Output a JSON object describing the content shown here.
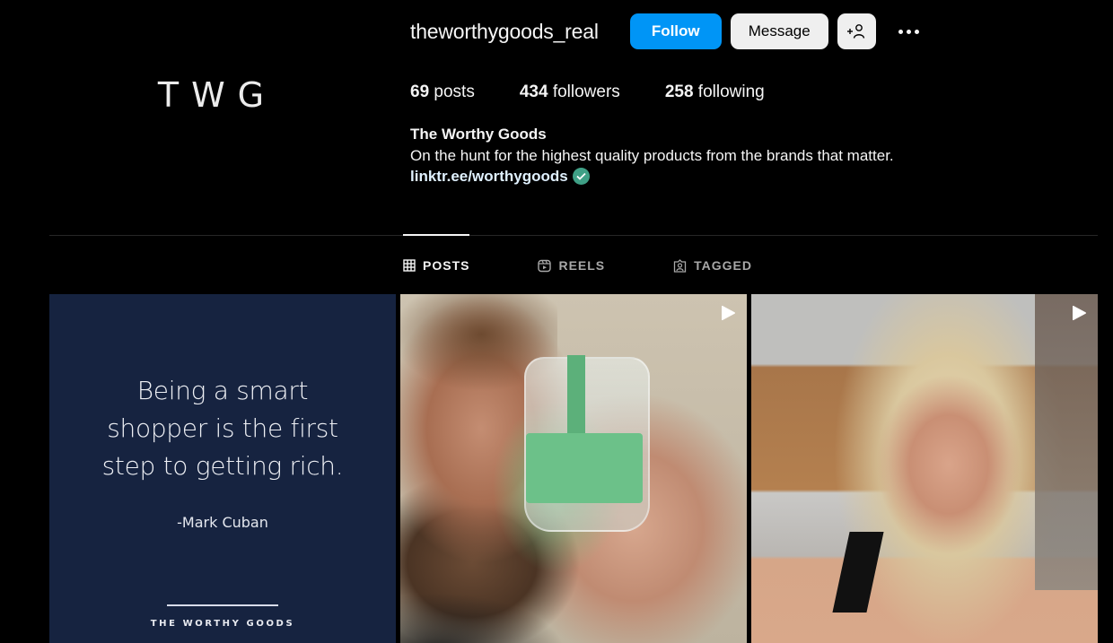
{
  "profile": {
    "logo_text": "TWG",
    "username": "theworthygoods_real",
    "buttons": {
      "follow": "Follow",
      "message": "Message",
      "suggest_icon": "add-person-icon",
      "more_icon": "more-horizontal-icon"
    },
    "stats": {
      "posts_count": "69",
      "posts_label": "posts",
      "followers_count": "434",
      "followers_label": "followers",
      "following_count": "258",
      "following_label": "following"
    },
    "bio": {
      "name": "The Worthy Goods",
      "text": "On the hunt for the highest quality products from the brands that matter.",
      "link": "linktr.ee/worthygoods",
      "link_icon": "verified-check-icon"
    }
  },
  "tabs": [
    {
      "label": "POSTS",
      "icon": "grid-icon",
      "active": true
    },
    {
      "label": "REELS",
      "icon": "reels-icon",
      "active": false
    },
    {
      "label": "TAGGED",
      "icon": "tagged-icon",
      "active": false
    }
  ],
  "posts": [
    {
      "type": "image",
      "quote_lines": [
        "Being a smart",
        "shopper is the first",
        "step to getting rich."
      ],
      "author": "-Mark Cuban",
      "brand": "THE WORTHY GOODS"
    },
    {
      "type": "reel",
      "description": "Man holding a jar of tooth powder",
      "overlay_icon": "play-icon"
    },
    {
      "type": "reel",
      "description": "Blonde woman in a kitchen",
      "overlay_icon": "play-icon"
    }
  ],
  "colors": {
    "follow_button": "#0095f6",
    "secondary_button": "#efefef",
    "verified": "#3fa086",
    "quote_background": "#162340",
    "background": "#000000"
  }
}
